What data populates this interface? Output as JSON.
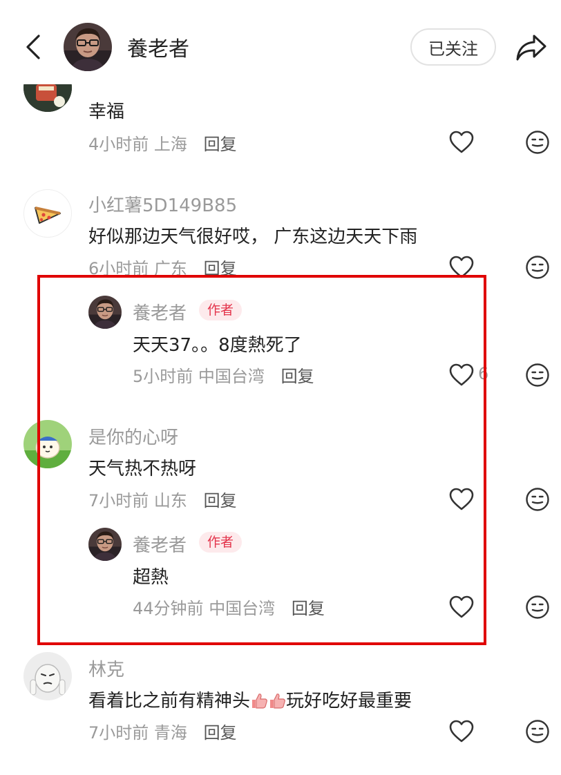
{
  "header": {
    "title": "養老者",
    "follow_label": "已关注"
  },
  "icons": {
    "back": "chevron-left-icon",
    "share": "share-arrow-icon",
    "like": "heart-outline-icon",
    "emoji": "emoji-face-icon",
    "thumbs_up": "thumbs-up-emoji"
  },
  "colors": {
    "author_badge_bg": "#fdeaec",
    "author_badge_text": "#e3344b",
    "highlight_border": "#e00000",
    "meta_text": "#9a9a9a"
  },
  "comments": [
    {
      "text": "幸福",
      "time": "4小时前",
      "location": "上海",
      "reply": "回复"
    },
    {
      "username": "小红薯5D149B85",
      "text": "好似那边天气很好哎， 广东这边天天下雨",
      "time": "6小时前",
      "location": "广东",
      "reply": "回复",
      "replies": [
        {
          "username": "養老者",
          "badge": "作者",
          "text": "天天37。。8度熱死了",
          "time": "5小时前",
          "location": "中国台湾",
          "reply": "回复",
          "likes": "6"
        }
      ]
    },
    {
      "username": "是你的心呀",
      "text": "天气热不热呀",
      "time": "7小时前",
      "location": "山东",
      "reply": "回复",
      "replies": [
        {
          "username": "養老者",
          "badge": "作者",
          "text": "超熱",
          "time": "44分钟前",
          "location": "中国台湾",
          "reply": "回复"
        }
      ]
    },
    {
      "username": "林克",
      "text_before": "看着比之前有精神头",
      "text_after": "玩好吃好最重要",
      "time": "7小时前",
      "location": "青海",
      "reply": "回复"
    }
  ]
}
